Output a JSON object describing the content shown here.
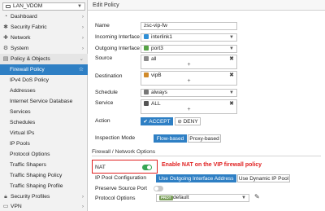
{
  "sidebar": {
    "vdom_selector": "LAN_VDOM",
    "items": [
      {
        "label": "Dashboard",
        "icon": "dashboard-icon"
      },
      {
        "label": "Security Fabric",
        "icon": "security-fabric-icon"
      },
      {
        "label": "Network",
        "icon": "network-icon"
      },
      {
        "label": "System",
        "icon": "gear-icon"
      },
      {
        "label": "Policy & Objects",
        "icon": "policy-icon"
      },
      {
        "label": "Firewall Policy",
        "icon": "star-icon"
      },
      {
        "label": "IPv4 DoS Policy"
      },
      {
        "label": "Addresses"
      },
      {
        "label": "Internet Service Database"
      },
      {
        "label": "Services"
      },
      {
        "label": "Schedules"
      },
      {
        "label": "Virtual IPs"
      },
      {
        "label": "IP Pools"
      },
      {
        "label": "Protocol Options"
      },
      {
        "label": "Traffic Shapers"
      },
      {
        "label": "Traffic Shaping Policy"
      },
      {
        "label": "Traffic Shaping Profile"
      },
      {
        "label": "Security Profiles",
        "icon": "lock-icon"
      },
      {
        "label": "VPN",
        "icon": "vpn-icon"
      }
    ]
  },
  "main": {
    "title": "Edit Policy",
    "form": {
      "name_label": "Name",
      "name_value": "zsc-vip-fw",
      "incoming_label": "Incoming Interface",
      "incoming_value": "interlink1",
      "outgoing_label": "Outgoing Interface",
      "outgoing_value": "port3",
      "source_label": "Source",
      "source_value": "all",
      "destination_label": "Destination",
      "destination_value": "vipB",
      "schedule_label": "Schedule",
      "schedule_value": "always",
      "service_label": "Service",
      "service_value": "ALL",
      "action_label": "Action",
      "action_accept": "✔ ACCEPT",
      "action_deny": "⊘ DENY",
      "inspection_label": "Inspection Mode",
      "inspection_flow": "Flow-based",
      "inspection_proxy": "Proxy-based"
    },
    "firewall_section": {
      "heading": "Firewall / Network Options",
      "nat_label": "NAT",
      "nat_enabled": true,
      "nat_annotation": "Enable NAT on the VIP firewall policy",
      "ippool_label": "IP Pool Configuration",
      "ippool_outgoing": "Use Outgoing Interface Address",
      "ippool_dynamic": "Use Dynamic IP Pool",
      "preserve_label": "Preserve Source Port",
      "preserve_enabled": false,
      "protocol_label": "Protocol Options",
      "protocol_badge": "PROT",
      "protocol_value": "default"
    }
  },
  "colors": {
    "accent": "#2e7fc4",
    "toggle_on": "#38a655",
    "annotation": "#e02020"
  }
}
